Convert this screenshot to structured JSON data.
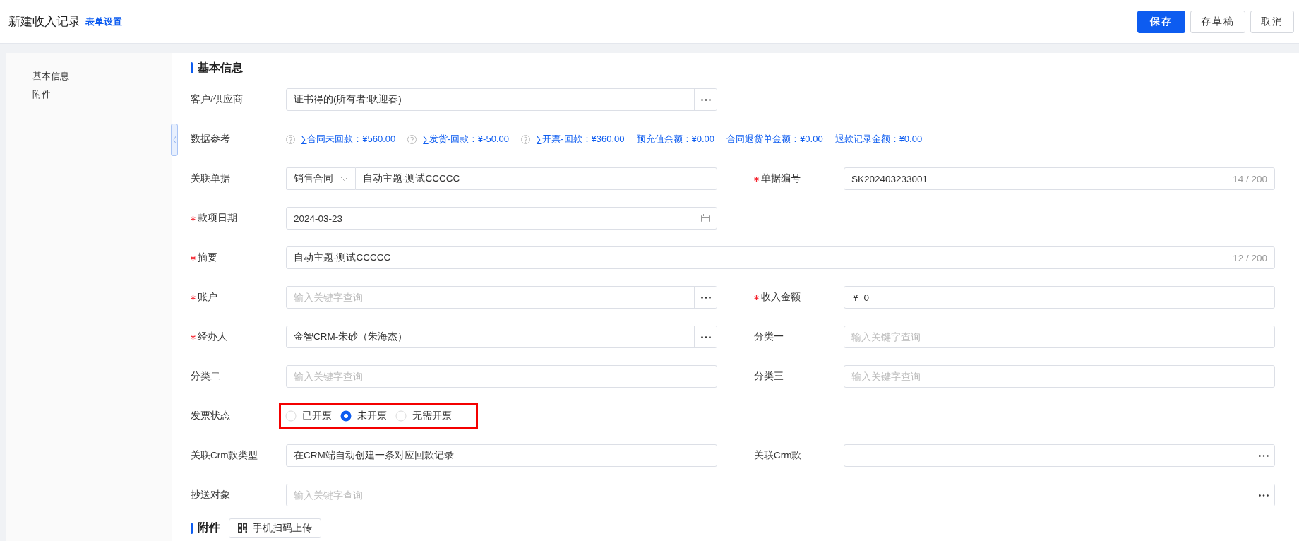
{
  "header": {
    "title": "新建收入记录",
    "settings_link": "表单设置",
    "buttons": [
      {
        "label": "保存",
        "kind": "primary"
      },
      {
        "label": "存草稿",
        "kind": "default"
      },
      {
        "label": "取消",
        "kind": "default"
      }
    ]
  },
  "sidebar": {
    "items": [
      "基本信息",
      "附件"
    ]
  },
  "form": {
    "title": "基本信息",
    "rows": [
      {
        "fields": [
          {
            "label": "客户/供应商",
            "required": false,
            "kind": "lookup",
            "wide": false,
            "value": "证书得的(所有者:耿迎春)"
          }
        ]
      },
      {
        "fields": [
          {
            "label": "数据参考",
            "kind": "refs",
            "refs": [
              {
                "text": "∑合同未回款：¥560.00",
                "kind": "help"
              },
              {
                "text": "∑发货-回款：¥-50.00",
                "kind": "help"
              },
              {
                "text": "∑开票-回款：¥360.00",
                "kind": "help"
              },
              {
                "text": "预充值余额：¥0.00",
                "kind": "plain"
              },
              {
                "text": "合同退货单金额：¥0.00",
                "kind": "plain"
              },
              {
                "text": "退款记录金额：¥0.00",
                "kind": "plain"
              }
            ]
          }
        ]
      },
      {
        "fields": [
          {
            "label": "关联单据",
            "required": false,
            "kind": "select-text",
            "wide": false,
            "option": "销售合同",
            "value": "自动主题-测试CCCCC"
          },
          {
            "label": "单据编号",
            "required": true,
            "kind": "text",
            "wide": false,
            "value": "SK202403233001",
            "counter": "14 / 200"
          }
        ]
      },
      {
        "fields": [
          {
            "label": "款项日期",
            "required": true,
            "kind": "date",
            "wide": false,
            "value": "2024-03-23"
          }
        ]
      },
      {
        "fields": [
          {
            "label": "摘要",
            "required": true,
            "kind": "text",
            "wide": true,
            "value": "自动主题-测试CCCCC",
            "counter": "12 / 200"
          }
        ]
      },
      {
        "fields": [
          {
            "label": "账户",
            "required": true,
            "kind": "lookup",
            "wide": false,
            "placeholder": "输入关键字查询"
          },
          {
            "label": "收入金额",
            "required": true,
            "kind": "money",
            "wide": false,
            "prefix": "¥",
            "value": "0"
          }
        ]
      },
      {
        "fields": [
          {
            "label": "经办人",
            "required": true,
            "kind": "lookup",
            "wide": false,
            "value": "金智CRM-朱砂（朱海杰）"
          },
          {
            "label": "分类一",
            "required": false,
            "kind": "text",
            "wide": false,
            "placeholder": "输入关键字查询"
          }
        ]
      },
      {
        "fields": [
          {
            "label": "分类二",
            "required": false,
            "kind": "text",
            "wide": false,
            "placeholder": "输入关键字查询"
          },
          {
            "label": "分类三",
            "required": false,
            "kind": "text",
            "wide": false,
            "placeholder": "输入关键字查询"
          }
        ]
      },
      {
        "fields": [
          {
            "label": "发票状态",
            "required": false,
            "kind": "radio",
            "wide": false,
            "highlighted": true,
            "options": [
              {
                "label": "已开票",
                "selected": false
              },
              {
                "label": "未开票",
                "selected": true
              },
              {
                "label": "无需开票",
                "selected": false
              }
            ]
          }
        ]
      },
      {
        "fields": [
          {
            "label": "关联Crm款类型",
            "required": false,
            "kind": "text",
            "wide": false,
            "value": "在CRM端自动创建一条对应回款记录"
          },
          {
            "label": "关联Crm款",
            "required": false,
            "kind": "lookup",
            "wide": false
          }
        ]
      },
      {
        "fields": [
          {
            "label": "抄送对象",
            "required": false,
            "kind": "lookup",
            "wide": true,
            "placeholder": "输入关键字查询"
          }
        ]
      }
    ]
  },
  "attachments": {
    "title": "附件",
    "upload_button": "手机扫码上传"
  }
}
